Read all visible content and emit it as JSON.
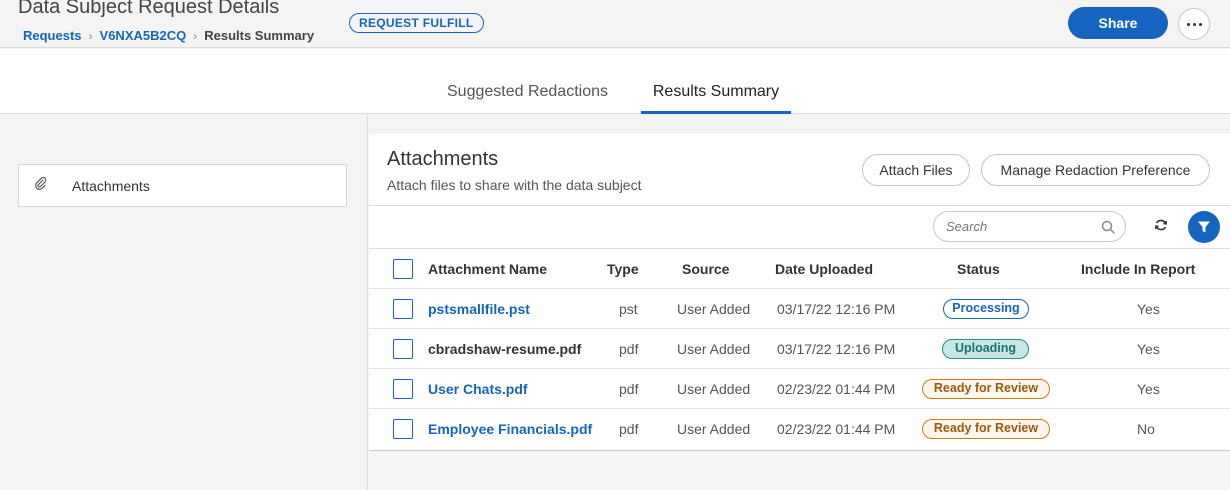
{
  "header": {
    "title": "Data Subject Request Details",
    "breadcrumb": [
      "Requests",
      "V6NXA5B2CQ",
      "Results Summary"
    ],
    "badge": "REQUEST FULFILL",
    "share_label": "Share",
    "more_icon": "more-horizontal-icon"
  },
  "tabs": [
    {
      "label": "Suggested Redactions",
      "active": false
    },
    {
      "label": "Results Summary",
      "active": true
    }
  ],
  "sidebar": {
    "items": [
      {
        "label": "Attachments",
        "icon": "paperclip-icon"
      }
    ]
  },
  "attachments": {
    "title": "Attachments",
    "subtitle": "Attach files to share with the data subject",
    "attach_files_label": "Attach Files",
    "manage_label": "Manage Redaction Preference",
    "search_placeholder": "Search",
    "columns": [
      "Attachment Name",
      "Type",
      "Source",
      "Date Uploaded",
      "Status",
      "Include In Report"
    ],
    "rows": [
      {
        "name": "pstsmallfile.pst",
        "link": true,
        "type": "pst",
        "source": "User Added",
        "date": "03/17/22 12:16 PM",
        "status": "Processing",
        "status_kind": "processing",
        "include": "Yes"
      },
      {
        "name": "cbradshaw-resume.pdf",
        "link": false,
        "type": "pdf",
        "source": "User Added",
        "date": "03/17/22 12:16 PM",
        "status": "Uploading",
        "status_kind": "uploading",
        "include": "Yes"
      },
      {
        "name": "User Chats.pdf",
        "link": true,
        "type": "pdf",
        "source": "User Added",
        "date": "02/23/22 01:44 PM",
        "status": "Ready for Review",
        "status_kind": "ready",
        "include": "Yes"
      },
      {
        "name": "Employee Financials.pdf",
        "link": true,
        "type": "pdf",
        "source": "User Added",
        "date": "02/23/22 01:44 PM",
        "status": "Ready for Review",
        "status_kind": "ready",
        "include": "No"
      }
    ]
  },
  "colors": {
    "accent": "#1565c0",
    "uploading": "#2a8a8a",
    "ready": "#c97a1e"
  }
}
